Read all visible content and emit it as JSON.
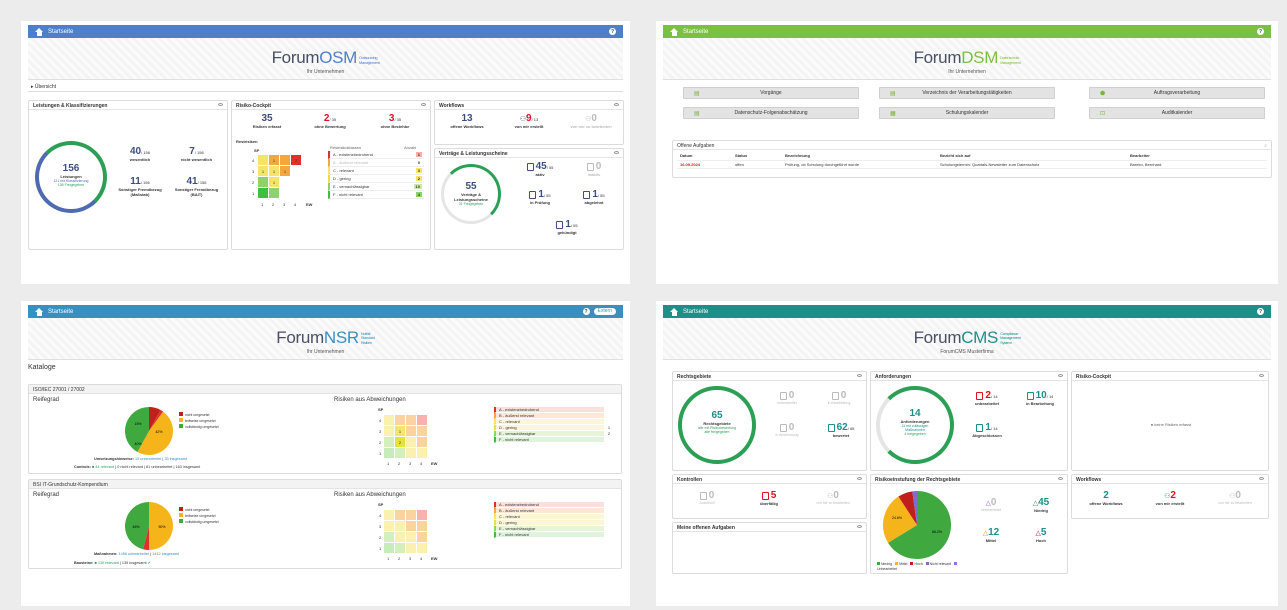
{
  "nav": {
    "home": "Startseite",
    "help": "?",
    "extern": "Extern"
  },
  "osm": {
    "color": "#4f7fc8",
    "brand1": "Forum",
    "brand2": "OSM",
    "sub1": "Outsourcing",
    "sub2": "Management",
    "tagline": "Ihr Unternehmen",
    "overview": "Übersicht",
    "p1": {
      "title": "Leistungen & Klassifizierungen",
      "ring_value": "156",
      "ring_label": "Leistungen",
      "ring_l2": "121 mit Klassifizierung",
      "ring_l3": "138 Freigegeben",
      "s1v": "40",
      "s1t": "/ 156",
      "s1l": "wesentlich",
      "s2v": "7",
      "s2t": "/ 156",
      "s2l": "nicht wesentlich",
      "s3v": "11",
      "s3t": "/ 156",
      "s3l": "Sonstiger Fremdbezug",
      "s3l2": "(Maßstab)",
      "s4v": "41",
      "s4t": "/ 156",
      "s4l": "Sonstiger Fremdbezug",
      "s4l2": "(BAIT)"
    },
    "p2": {
      "title": "Risiko-Cockpit",
      "a": "35",
      "al": "Risiken erfasst",
      "b": "2",
      "bt": "/ 35",
      "bl": "ohne Bewertung",
      "c": "3",
      "ct": "/ 35",
      "cl": "ohne Bestehbe",
      "hm": "Restrisiken",
      "sp": "SP",
      "ew": "EW",
      "col1": "Restrisikoklassen",
      "col2": "Anzahl",
      "classes": [
        [
          "A - existenzbedrohend",
          "1"
        ],
        [
          "B - äußerst relevant",
          "0"
        ],
        [
          "C - relevant",
          "3"
        ],
        [
          "D - gering",
          "2"
        ],
        [
          "E - vernachlässigbar",
          "10"
        ],
        [
          "F - nicht relevant",
          "4"
        ]
      ]
    },
    "p3": {
      "title": "Workflows",
      "a": "13",
      "al": "offene Workflows",
      "b": "9",
      "bt": "/ 13",
      "bl": "von mir erstellt",
      "c": "0",
      "cl": "von mir zu bearbeiten"
    },
    "p4": {
      "title": "Verträge & Leistungsscheine",
      "rv": "55",
      "rl1": "Verträge &",
      "rl2": "Leistungsscheine",
      "rl3": "31 Freigegeben",
      "a": "45",
      "at": "/ 55",
      "al": "aktiv",
      "b": "0",
      "bl": "inaktiv",
      "c": "1",
      "ct": "/ 55",
      "cl": "in Prüfung",
      "d": "1",
      "dt": "/ 55",
      "dl": "abgelehnt",
      "e": "1",
      "et": "/ 55",
      "el": "gekündigt"
    }
  },
  "dsm": {
    "color": "#7cc043",
    "brand1": "Forum",
    "brand2": "DSM",
    "sub1": "Datenschutz",
    "sub2": "Management",
    "tagline": "Ihr Unternehmen",
    "btns": [
      "Vorgänge",
      "Verzeichnis der Verarbeitungstätigkeiten",
      "Auftragsverarbeitung",
      "Datenschutz-Folgenabschätzung",
      "Schulungskalender",
      "Auditkalender"
    ],
    "tasks_title": "Offene Aufgaben",
    "cols": [
      "Datum",
      "Status",
      "Bezeichnung",
      "Bezieht sich auf",
      "Bearbeiter"
    ],
    "row": [
      "16.09.2024",
      "offen",
      "Prüfung, ob Schulung durchgeführt wurde",
      "Schulungstermin: Quartals-Newsletter zum Datenschutz",
      "Bareko, Bernhard"
    ]
  },
  "nsr": {
    "color": "#3a8fc1",
    "brand1": "Forum",
    "brand2": "NSR",
    "sub1": "Notfall",
    "sub2": "Standard",
    "sub3": "Risiken",
    "tagline": "Ihr Unternehmen",
    "catalogs": "Kataloge",
    "sections": [
      {
        "head": "ISO/IEC 27001 / 27002",
        "left": "Reifegrad",
        "right": "Risiken aus Abweichungen",
        "pie": [
          "15%",
          "42%",
          "40%"
        ],
        "legend": [
          "nicht umgesetzt",
          "teilweise umgesetzt",
          "vollständig umgesetzt"
        ],
        "line1a": "Umsetzungshinweise:",
        "line1b": "13 unbearbeitet",
        "line1c": "33 insgesamt",
        "line2a": "Controls:",
        "line2b": "44 relevant",
        "line2c": "0 nicht relevant",
        "line2d": "81 unbearbeitet",
        "line2e": "163 insgesamt"
      },
      {
        "head": "BSI IT-Grundschutz-Kompendium",
        "left": "Reifegrad",
        "right": "Risiken aus Abweichungen",
        "pie": [
          "46%",
          "50%"
        ],
        "legend": [
          "nicht umgesetzt",
          "teilweise umgesetzt",
          "vollständig umgesetzt"
        ],
        "line1a": "Maßnahmen:",
        "line1b": "1456 unbearbeitet",
        "line1c": "1412 insgesamt",
        "line2a": "Bausteine:",
        "line2b": "130 relevant",
        "line2c": "139 insgesamt",
        "line2d": "",
        "line2e": ""
      }
    ],
    "classes": [
      "A - existenzbedrohend",
      "B - äußerst relevant",
      "C - relevant",
      "D - gering",
      "E - vernachlässigbar",
      "F - nicht relevant"
    ],
    "counts1": [
      "",
      "",
      "",
      "1",
      "2",
      ""
    ]
  },
  "cms": {
    "color": "#1d8f89",
    "brand1": "Forum",
    "brand2": "CMS",
    "sub1": "Compliance",
    "sub2": "Management",
    "sub3": "System",
    "tagline": "ForumCMS Musterfirma",
    "p1": {
      "title": "Rechtsgebiete",
      "rv": "65",
      "rl": "Rechtsgebiete",
      "rl2": "alle mit Risikobewertung",
      "rl3": "alle freigegeben",
      "a": "0",
      "al": "unbearbeitet",
      "b": "0",
      "bl": "in Bearbeitung",
      "c": "0",
      "cl": "in Abstimmung",
      "d": "62",
      "dt": "/ 65",
      "dl": "bewertet"
    },
    "p2": {
      "title": "Anforderungen",
      "rv": "14",
      "rl": "Anforderungen",
      "rl2": "11 mit zulässigen",
      "rl3": "Maßnahmen",
      "rl4": "4 freigegeben",
      "a": "2",
      "at": "/ 14",
      "al": "unbearbeitet",
      "b": "10",
      "bt": "/ 14",
      "bl": "in Bearbeitung",
      "c": "1",
      "ct": "/ 14",
      "cl": "Abgeschlossen"
    },
    "p3": {
      "title": "Risiko-Cockpit",
      "msg": "keine Risiken erfasst"
    },
    "p4": {
      "title": "Kontrollen",
      "a": "0",
      "al": "Anzeitsoll",
      "b": "5",
      "bl": "überfällig",
      "c": "0",
      "cl": "von mir zu bearbeiten"
    },
    "p5": {
      "title": "Risikoeinstufung der Rechtsgebiete",
      "pie": [
        "24.6%",
        "66.2%"
      ],
      "a": "0",
      "al": "Unbearbeitet",
      "b": "45",
      "bl": "Niedrig",
      "c": "12",
      "cl": "Mittel",
      "d": "5",
      "dl": "Hoch",
      "legend": [
        "Niedrig",
        "Mittel",
        "Hoch",
        "Nicht relevant",
        "Unbearbeitet"
      ]
    },
    "p6": {
      "title": "Workflows",
      "a": "2",
      "al": "offene Workflows",
      "b": "2",
      "bl": "von mir erstellt",
      "c": "0",
      "cl": "von mir zu bearbeiten"
    },
    "p7": {
      "title": "Meine offenen Aufgaben"
    }
  }
}
